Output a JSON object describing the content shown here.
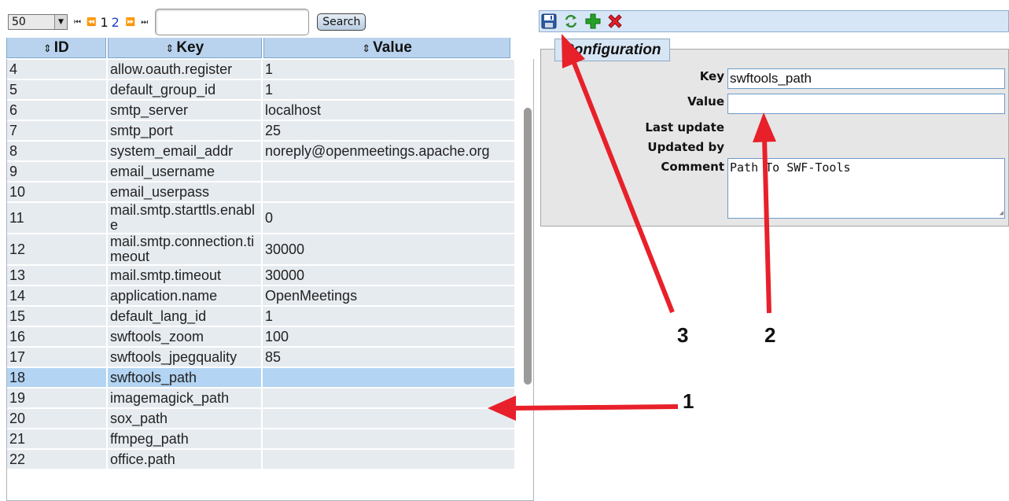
{
  "pager": {
    "page_size": "50",
    "icons": [
      "first-page-icon",
      "prev-page-icon",
      "next-page-icon",
      "last-page-icon"
    ],
    "first_glyph": "⏮",
    "prev_glyph": "⏪",
    "next_glyph": "⏩",
    "last_glyph": "⏭",
    "pages": [
      "1",
      "2"
    ],
    "search_value": "",
    "search_label": "Search"
  },
  "grid": {
    "columns": [
      "ID",
      "Key",
      "Value"
    ],
    "sort_glyph": "⇕",
    "rows": [
      {
        "id": "4",
        "key": "allow.oauth.register",
        "value": "1"
      },
      {
        "id": "5",
        "key": "default_group_id",
        "value": "1"
      },
      {
        "id": "6",
        "key": "smtp_server",
        "value": "localhost"
      },
      {
        "id": "7",
        "key": "smtp_port",
        "value": "25"
      },
      {
        "id": "8",
        "key": "system_email_addr",
        "value": "noreply@openmeetings.apache.org"
      },
      {
        "id": "9",
        "key": "email_username",
        "value": ""
      },
      {
        "id": "10",
        "key": "email_userpass",
        "value": ""
      },
      {
        "id": "11",
        "key": "mail.smtp.starttls.enable",
        "value": "0"
      },
      {
        "id": "12",
        "key": "mail.smtp.connection.timeout",
        "value": "30000"
      },
      {
        "id": "13",
        "key": "mail.smtp.timeout",
        "value": "30000"
      },
      {
        "id": "14",
        "key": "application.name",
        "value": "OpenMeetings"
      },
      {
        "id": "15",
        "key": "default_lang_id",
        "value": "1"
      },
      {
        "id": "16",
        "key": "swftools_zoom",
        "value": "100"
      },
      {
        "id": "17",
        "key": "swftools_jpegquality",
        "value": "85"
      },
      {
        "id": "18",
        "key": "swftools_path",
        "value": "",
        "selected": true
      },
      {
        "id": "19",
        "key": "imagemagick_path",
        "value": ""
      },
      {
        "id": "20",
        "key": "sox_path",
        "value": ""
      },
      {
        "id": "21",
        "key": "ffmpeg_path",
        "value": ""
      },
      {
        "id": "22",
        "key": "office.path",
        "value": ""
      }
    ]
  },
  "toolbar": {
    "icons": [
      "save-icon",
      "refresh-icon",
      "add-icon",
      "delete-icon"
    ]
  },
  "form": {
    "legend": "Configuration",
    "key_label": "Key",
    "key_value": "swftools_path",
    "value_label": "Value",
    "value_value": "",
    "last_update_label": "Last update",
    "updated_by_label": "Updated by",
    "comment_label": "Comment",
    "comment_value": "Path To SWF-Tools"
  },
  "annotations": {
    "numbers": [
      "1",
      "2",
      "3"
    ],
    "arrow_color": "#e8202a"
  }
}
